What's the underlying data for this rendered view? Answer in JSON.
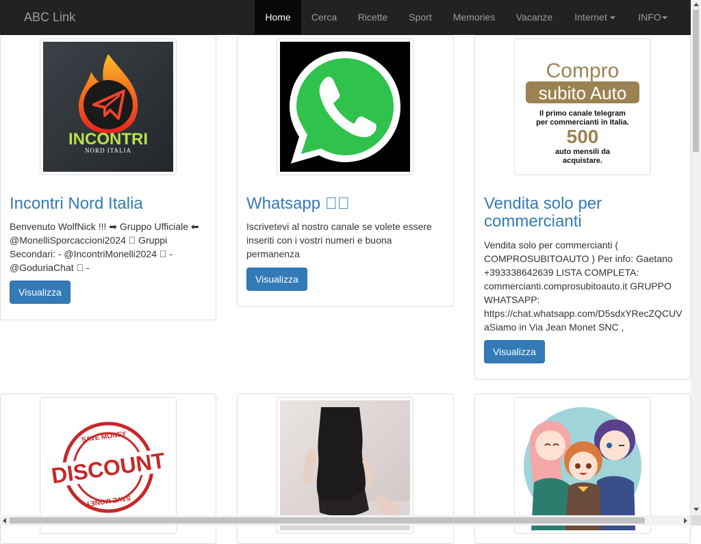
{
  "navbar": {
    "brand": "ABC Link",
    "items": [
      {
        "label": "Home"
      },
      {
        "label": "Cerca"
      },
      {
        "label": "Ricette"
      },
      {
        "label": "Sport"
      },
      {
        "label": "Memories"
      },
      {
        "label": "Vacanze"
      },
      {
        "label": "Internet"
      },
      {
        "label": "INFO"
      }
    ]
  },
  "cards": [
    {
      "title": "Incontri Nord Italia",
      "description": "Benvenuto WolfNick !!! ➡ Gruppo Ufficiale ⬅ @MonelliSporcaccioni2024 ⃣ Gruppi Secondari: - @IncontriMonelli2024 ⃣ - @GoduriaChat ⃣ -",
      "button": "Visualizza",
      "image": {
        "logo_word": "INCONTRI",
        "logo_sub": "NORD ITALIA"
      }
    },
    {
      "title": "Whatsapp ⃣⃣",
      "description": "Iscrivetevi al nostro canale se volete essere inseriti con i vostri numeri e buona permanenza",
      "button": "Visualizza",
      "image": {}
    },
    {
      "title": "Vendita solo per commercianti",
      "description": "Vendita solo per commercianti ( COMPROSUBITOAUTO ) Per info: Gaetano +393338642639 LISTA COMPLETA: commercianti.comprosubitoauto.it GRUPPO WHATSAPP: https://chat.whatsapp.com/D5sdxYRecZQCUVaSiamo in Via Jean Monet SNC ,",
      "button": "Visualizza",
      "image": {
        "line1": "Compro",
        "line2": "subito Auto",
        "line3": "Il primo canale telegram",
        "line4": "per commercianti in Italia.",
        "number": "500",
        "line5": "auto mensili da",
        "line6": "acquistare."
      }
    },
    {
      "image": {
        "stamp_text": "DISCOUNT",
        "ring_text": "SAVE MONEY"
      }
    },
    {
      "image": {}
    },
    {
      "image": {}
    }
  ]
}
